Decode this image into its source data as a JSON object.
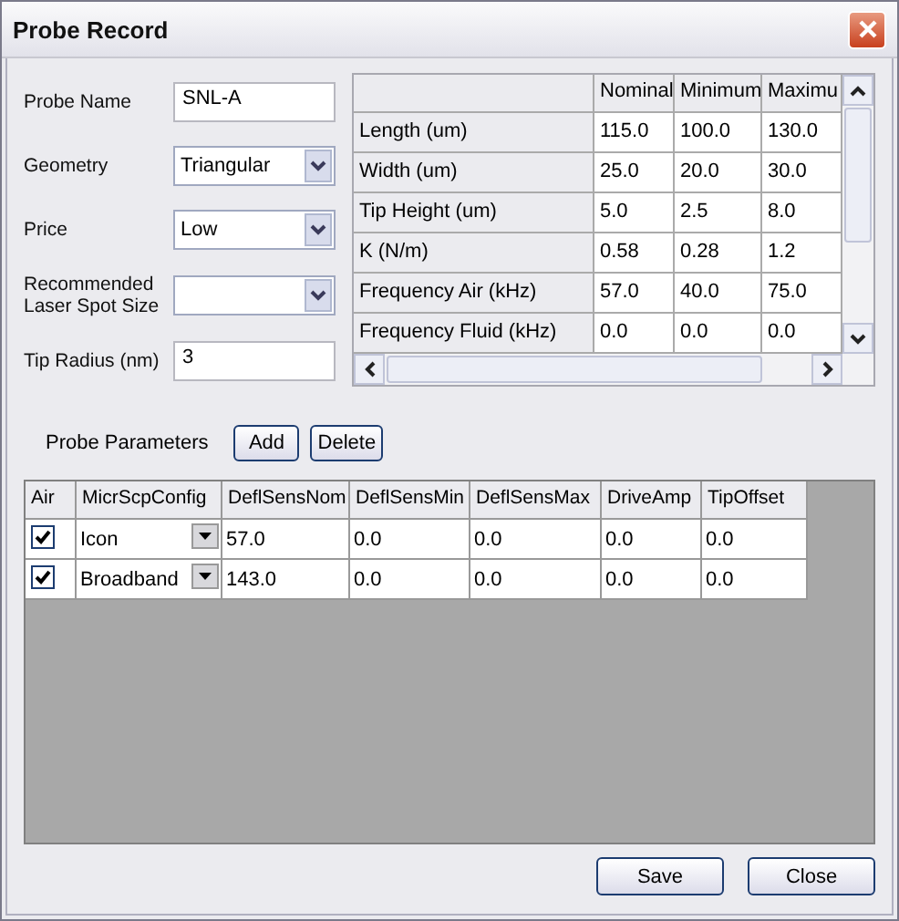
{
  "window": {
    "title": "Probe Record"
  },
  "fields": [
    {
      "kind": "text",
      "label": "Probe Name",
      "value": "SNL-A"
    },
    {
      "kind": "select",
      "label": "Geometry",
      "value": "Triangular"
    },
    {
      "kind": "select",
      "label": "Price",
      "value": "Low"
    },
    {
      "kind": "select",
      "label": "Recommended Laser Spot Size"
    },
    {
      "kind": "text",
      "label": "Tip Radius (nm)",
      "value": "3"
    }
  ],
  "spec_table": {
    "columns": [
      "Nominal",
      "Minimum",
      "Maximu"
    ],
    "rows": [
      {
        "label": "Length (um)",
        "cells": [
          "115.0",
          "100.0",
          "130.0"
        ]
      },
      {
        "label": "Width (um)",
        "cells": [
          "25.0",
          "20.0",
          "30.0"
        ]
      },
      {
        "label": "Tip Height (um)",
        "cells": [
          "5.0",
          "2.5",
          "8.0"
        ]
      },
      {
        "label": "K (N/m)",
        "cells": [
          "0.58",
          "0.28",
          "1.2"
        ]
      },
      {
        "label": "Frequency Air (kHz)",
        "cells": [
          "57.0",
          "40.0",
          "75.0"
        ]
      },
      {
        "label": "Frequency Fluid (kHz)",
        "cells": [
          "0.0",
          "0.0",
          "0.0"
        ]
      }
    ]
  },
  "probe_parameters": {
    "label": "Probe Parameters",
    "buttons": [
      "Add",
      "Delete"
    ],
    "columns": [
      "Air",
      "MicrScpConfig",
      "DeflSensNom",
      "DeflSensMin",
      "DeflSensMax",
      "DriveAmp",
      "TipOffset"
    ],
    "rows": [
      {
        "cells": [
          {
            "kind": "checkbox",
            "checked": true
          },
          {
            "kind": "select",
            "value": "Icon"
          },
          {
            "kind": "text",
            "value": "57.0"
          },
          {
            "kind": "text",
            "value": "0.0"
          },
          {
            "kind": "text",
            "value": "0.0"
          },
          {
            "kind": "text",
            "value": "0.0"
          },
          {
            "kind": "text",
            "value": "0.0"
          }
        ]
      },
      {
        "cells": [
          {
            "kind": "checkbox",
            "checked": true
          },
          {
            "kind": "select",
            "value": "Broadband"
          },
          {
            "kind": "text",
            "value": "143.0"
          },
          {
            "kind": "text",
            "value": "0.0"
          },
          {
            "kind": "text",
            "value": "0.0"
          },
          {
            "kind": "text",
            "value": "0.0"
          },
          {
            "kind": "text",
            "value": "0.0"
          }
        ]
      }
    ]
  },
  "buttons": [
    "Save",
    "Close"
  ]
}
